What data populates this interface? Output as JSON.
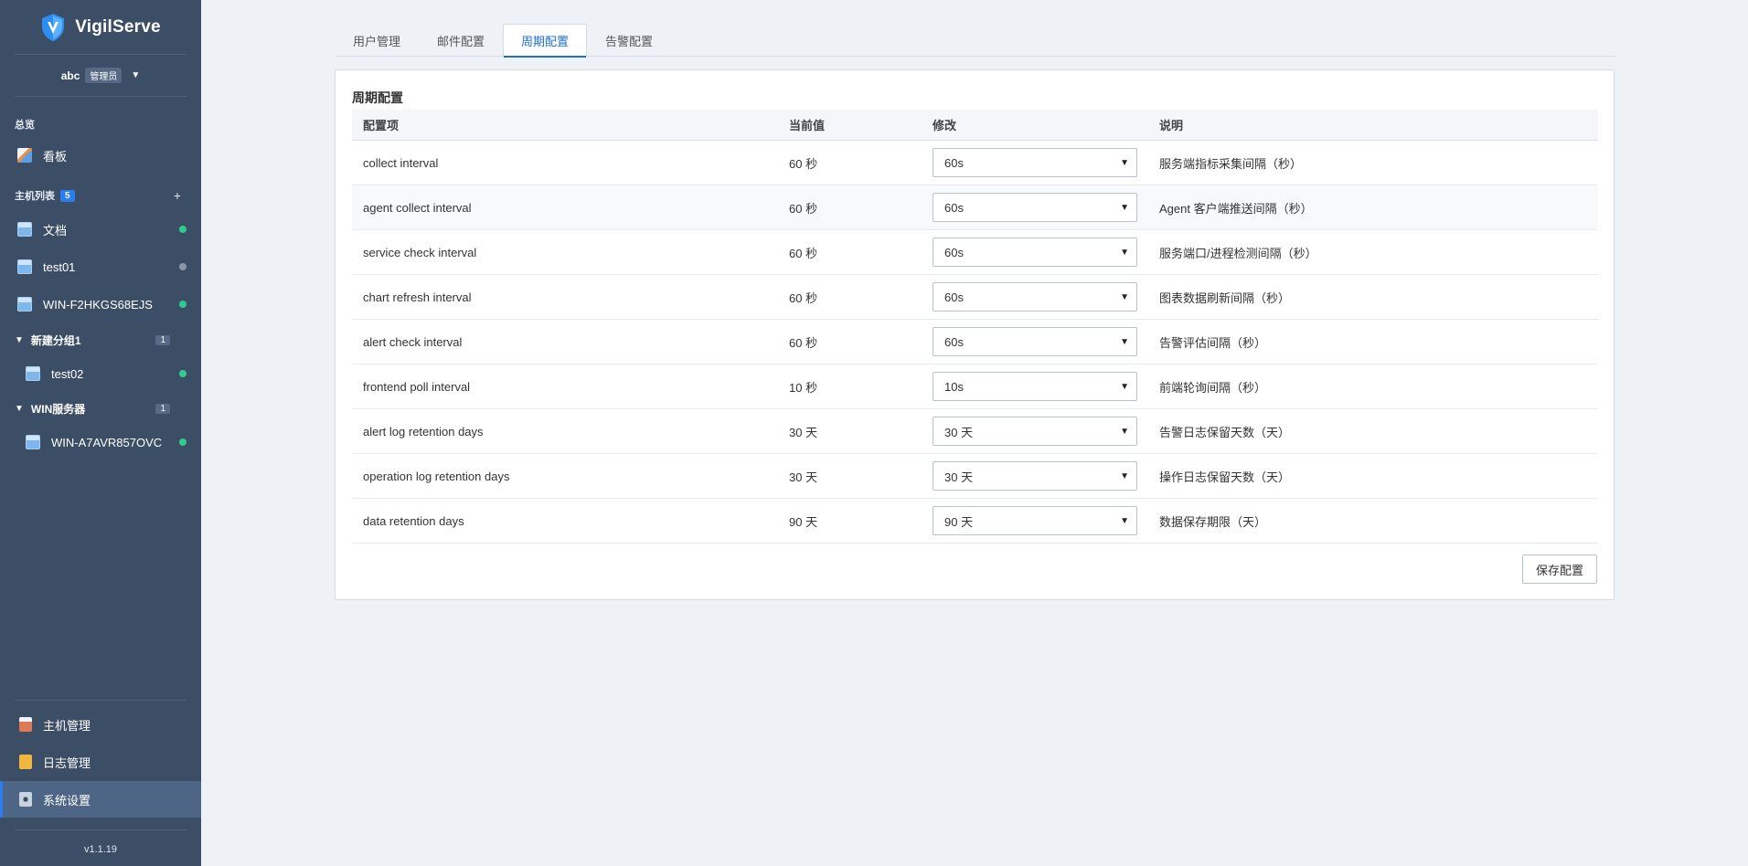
{
  "app": {
    "name": "VigilServe",
    "version": "v1.1.19"
  },
  "user": {
    "name": "abc",
    "role": "管理员"
  },
  "sidebar": {
    "overview_label": "总览",
    "dashboard_label": "看板",
    "hosts_label": "主机列表",
    "hosts_count": "5",
    "add_symbol": "+",
    "hosts": [
      {
        "name": "文档",
        "status": "online"
      },
      {
        "name": "test01",
        "status": "offline"
      },
      {
        "name": "WIN-F2HKGS68EJS",
        "status": "online"
      }
    ],
    "groups": [
      {
        "name": "新建分组1",
        "count": "1",
        "hosts": [
          {
            "name": "test02",
            "status": "online"
          }
        ]
      },
      {
        "name": "WIN服务器",
        "count": "1",
        "hosts": [
          {
            "name": "WIN-A7AVR857OVC",
            "status": "online"
          }
        ]
      }
    ],
    "bottom": [
      {
        "label": "主机管理",
        "icon": "clipboard-icon"
      },
      {
        "label": "日志管理",
        "icon": "log-icon"
      },
      {
        "label": "系统设置",
        "icon": "gear-icon",
        "active": true
      }
    ]
  },
  "tabs": [
    {
      "label": "用户管理",
      "active": false
    },
    {
      "label": "邮件配置",
      "active": false
    },
    {
      "label": "周期配置",
      "active": true
    },
    {
      "label": "告警配置",
      "active": false
    }
  ],
  "panel": {
    "title": "周期配置",
    "headers": {
      "item": "配置项",
      "current": "当前值",
      "modify": "修改",
      "desc": "说明"
    },
    "rows": [
      {
        "item": "collect interval",
        "current": "60 秒",
        "select": "60s",
        "desc": "服务端指标采集间隔（秒）"
      },
      {
        "item": "agent collect interval",
        "current": "60 秒",
        "select": "60s",
        "desc": "Agent 客户端推送间隔（秒）"
      },
      {
        "item": "service check interval",
        "current": "60 秒",
        "select": "60s",
        "desc": "服务端口/进程检测间隔（秒）"
      },
      {
        "item": "chart refresh interval",
        "current": "60 秒",
        "select": "60s",
        "desc": "图表数据刷新间隔（秒）"
      },
      {
        "item": "alert check interval",
        "current": "60 秒",
        "select": "60s",
        "desc": "告警评估间隔（秒）"
      },
      {
        "item": "frontend poll interval",
        "current": "10 秒",
        "select": "10s",
        "desc": "前端轮询间隔（秒）"
      },
      {
        "item": "alert log retention days",
        "current": "30 天",
        "select": "30 天",
        "desc": "告警日志保留天数（天）"
      },
      {
        "item": "operation log retention days",
        "current": "30 天",
        "select": "30 天",
        "desc": "操作日志保留天数（天）"
      },
      {
        "item": "data retention days",
        "current": "90 天",
        "select": "90 天",
        "desc": "数据保存期限（天）"
      }
    ],
    "save_label": "保存配置"
  },
  "colors": {
    "sidebar_bg": "#3c4e66",
    "accent": "#1e6fd9",
    "online": "#2ecc8f",
    "offline": "#8d97a6"
  }
}
